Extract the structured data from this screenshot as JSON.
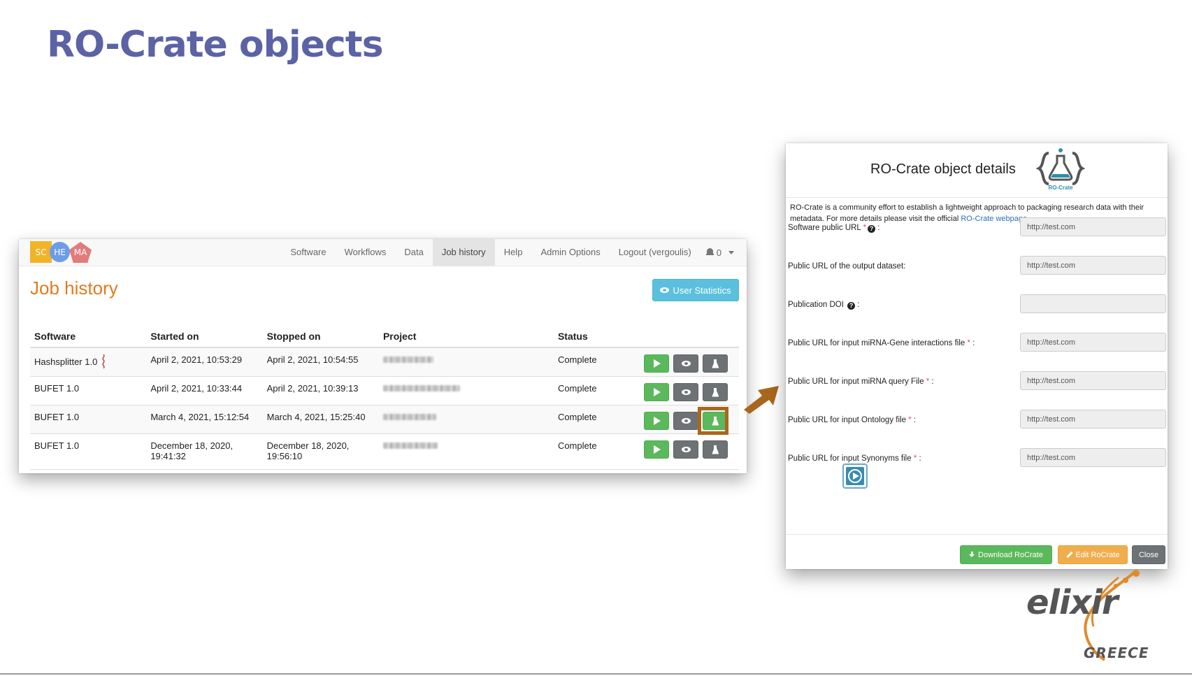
{
  "slide": {
    "title": "RO-Crate objects"
  },
  "job_history": {
    "logo_letters": [
      "SC",
      "HE",
      "MA"
    ],
    "nav": [
      "Software",
      "Workflows",
      "Data",
      "Job history",
      "Help",
      "Admin Options",
      "Logout (vergoulis)"
    ],
    "nav_active": "Job history",
    "notifications_count": "0",
    "heading": "Job history",
    "user_stats_label": "User Statistics",
    "columns": [
      "Software",
      "Started on",
      "Stopped on",
      "Project",
      "Status"
    ],
    "rows": [
      {
        "software": "Hashsplitter 1.0",
        "started": "April 2, 2021, 10:53:29",
        "stopped": "April 2, 2021, 10:54:55",
        "status": "Complete",
        "project_blurred": true
      },
      {
        "software": "BUFET 1.0",
        "started": "April 2, 2021, 10:33:44",
        "stopped": "April 2, 2021, 10:39:13",
        "status": "Complete",
        "project_blurred": true
      },
      {
        "software": "BUFET 1.0",
        "started": "March 4, 2021, 15:12:54",
        "stopped": "March 4, 2021, 15:25:40",
        "status": "Complete",
        "project_blurred": true,
        "highlighted_action": "ro-crate"
      },
      {
        "software": "BUFET 1.0",
        "started": "December 18, 2020, 19:41:32",
        "stopped": "December 18, 2020, 19:56:10",
        "status": "Complete",
        "project_blurred": true
      }
    ]
  },
  "ro_modal": {
    "title": "RO-Crate object details",
    "logo_caption": "RO-Crate",
    "intro_text": "RO-Crate is a community effort to establish a lightweight approach to packaging research data with their metadata. For more details please visit the official ",
    "intro_link": "RO-Crate webpage",
    "intro_end": ".",
    "fields": [
      {
        "label": "Software public URL",
        "required": true,
        "help": true,
        "value": "http://test.com"
      },
      {
        "label": "Public URL of the output dataset",
        "required": false,
        "help": false,
        "value": "http://test.com"
      },
      {
        "label": "Publication DOI",
        "required": false,
        "help": true,
        "value": ""
      },
      {
        "label": "Public URL for input miRNA-Gene interactions file",
        "required": true,
        "help": false,
        "value": "http://test.com"
      },
      {
        "label": "Public URL for input miRNA query File",
        "required": true,
        "help": false,
        "value": "http://test.com"
      },
      {
        "label": "Public URL for input Ontology file",
        "required": true,
        "help": false,
        "value": "http://test.com"
      },
      {
        "label": "Public URL for input Synonyms file",
        "required": true,
        "help": false,
        "value": "http://test.com"
      }
    ],
    "buttons": {
      "download": "Download RoCrate",
      "edit": "Edit RoCrate",
      "close": "Close"
    }
  },
  "branding": {
    "word": "elixir",
    "sub": "GREECE"
  },
  "colors": {
    "title": "#5b63a5",
    "heading": "#e07b1f",
    "success": "#5cb85c",
    "info": "#5bc0de",
    "warning": "#f0ad4e",
    "highlight": "#a9671d"
  }
}
